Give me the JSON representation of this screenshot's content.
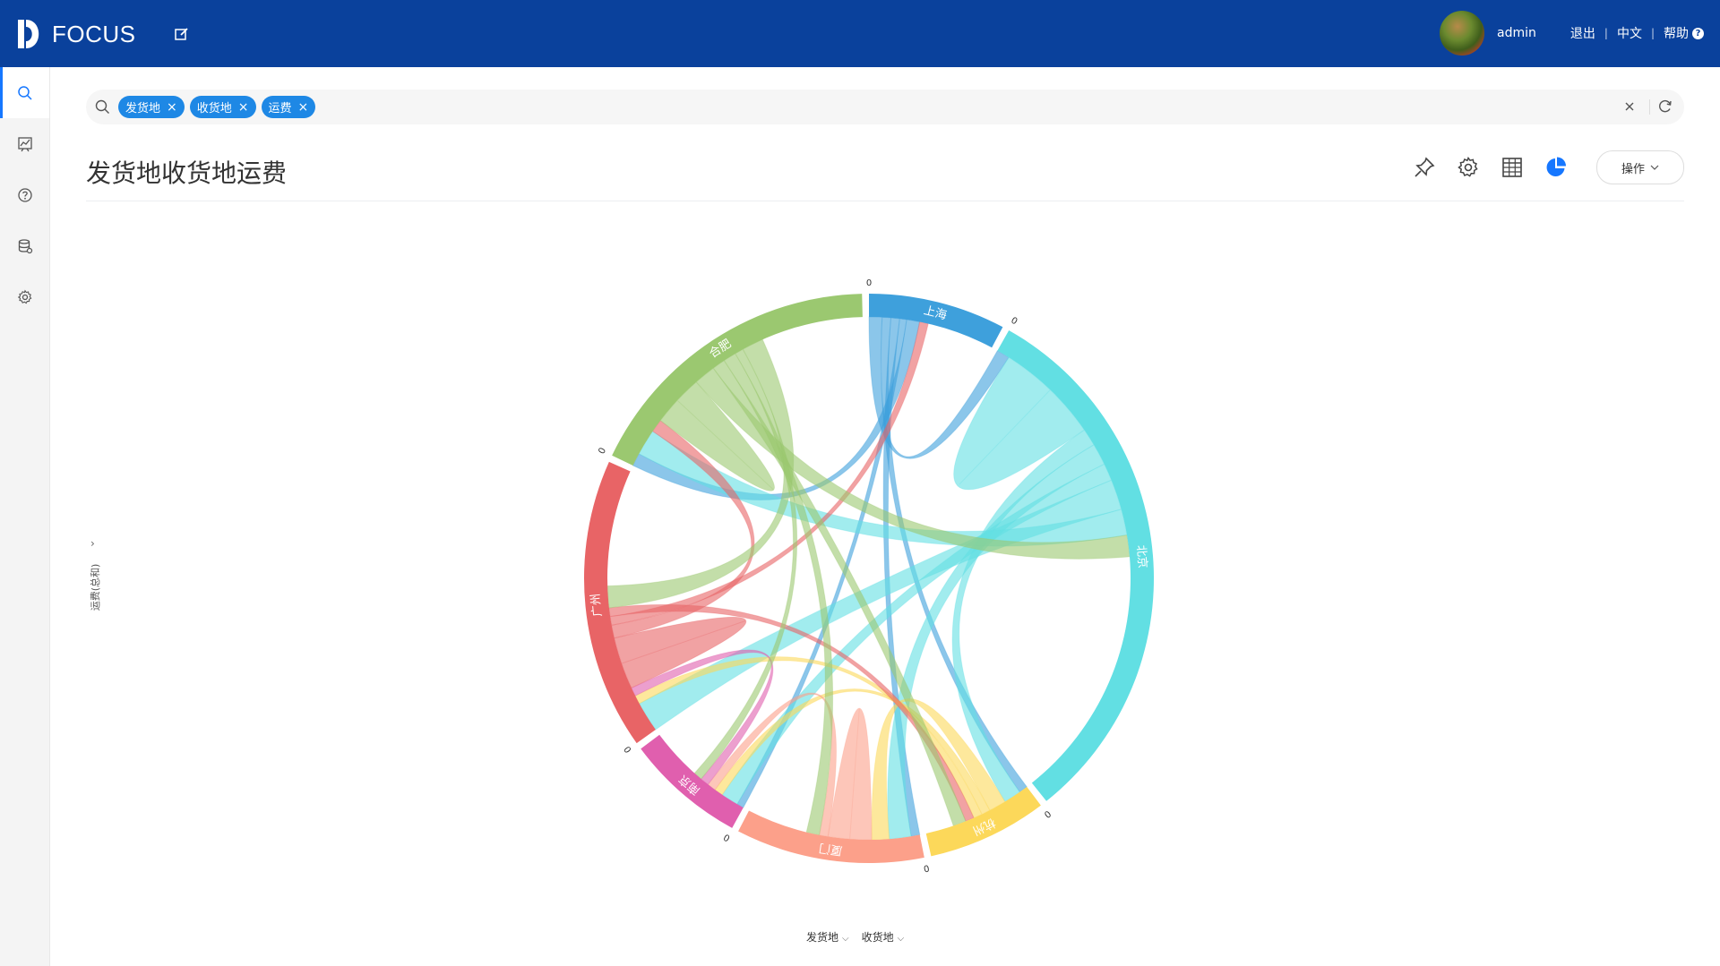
{
  "app": {
    "name": "FOCUS"
  },
  "header": {
    "user": "admin",
    "logout": "退出",
    "language": "中文",
    "help": "帮助",
    "help_icon_glyph": "?"
  },
  "sidebar": {
    "items": [
      {
        "name": "search",
        "icon": "search-icon",
        "active": true
      },
      {
        "name": "dashboard",
        "icon": "chart-board-icon",
        "active": false
      },
      {
        "name": "help",
        "icon": "question-icon",
        "active": false
      },
      {
        "name": "data",
        "icon": "database-icon",
        "active": false
      },
      {
        "name": "settings",
        "icon": "gear-icon",
        "active": false
      }
    ]
  },
  "search": {
    "tags": [
      {
        "label": "发货地"
      },
      {
        "label": "收货地"
      },
      {
        "label": "运费"
      }
    ],
    "tag_remove_glyph": "×",
    "clear_glyph": "×"
  },
  "page": {
    "title": "发货地收货地运费"
  },
  "toolbar": {
    "ops_label": "操作"
  },
  "chart_data": {
    "type": "chord",
    "y_label": "运费(总和)",
    "x_fields": [
      "发货地",
      "收货地"
    ],
    "nodes": [
      {
        "name": "上海",
        "color": "#3ea0dc"
      },
      {
        "name": "北京",
        "color": "#62dfe3"
      },
      {
        "name": "杭州",
        "color": "#fcd85a"
      },
      {
        "name": "厦门",
        "color": "#fca08a"
      },
      {
        "name": "南京",
        "color": "#e05fae"
      },
      {
        "name": "广州",
        "color": "#e86466"
      },
      {
        "name": "合肥",
        "color": "#9bc870"
      }
    ],
    "arc_values": [
      8,
      32,
      7,
      11,
      7,
      17,
      18
    ],
    "start_tick_label": "0",
    "links": [
      {
        "source": "上海",
        "target": "北京",
        "value": 1.5
      },
      {
        "source": "上海",
        "target": "杭州",
        "value": 1
      },
      {
        "source": "上海",
        "target": "厦门",
        "value": 1
      },
      {
        "source": "上海",
        "target": "南京",
        "value": 0.8
      },
      {
        "source": "上海",
        "target": "合肥",
        "value": 1.5
      },
      {
        "source": "北京",
        "target": "北京",
        "value": 6
      },
      {
        "source": "北京",
        "target": "杭州",
        "value": 2
      },
      {
        "source": "北京",
        "target": "厦门",
        "value": 2.5
      },
      {
        "source": "北京",
        "target": "南京",
        "value": 2
      },
      {
        "source": "北京",
        "target": "广州",
        "value": 3.5
      },
      {
        "source": "北京",
        "target": "合肥",
        "value": 3
      },
      {
        "source": "杭州",
        "target": "厦门",
        "value": 2
      },
      {
        "source": "杭州",
        "target": "南京",
        "value": 1
      },
      {
        "source": "杭州",
        "target": "广州",
        "value": 1
      },
      {
        "source": "厦门",
        "target": "厦门",
        "value": 2.5
      },
      {
        "source": "厦门",
        "target": "南京",
        "value": 1
      },
      {
        "source": "南京",
        "target": "广州",
        "value": 1
      },
      {
        "source": "广州",
        "target": "广州",
        "value": 3
      },
      {
        "source": "广州",
        "target": "合肥",
        "value": 1.5
      },
      {
        "source": "广州",
        "target": "上海",
        "value": 1
      },
      {
        "source": "广州",
        "target": "杭州",
        "value": 1
      },
      {
        "source": "合肥",
        "target": "合肥",
        "value": 3
      },
      {
        "source": "合肥",
        "target": "北京",
        "value": 2.5
      },
      {
        "source": "合肥",
        "target": "杭州",
        "value": 1.5
      },
      {
        "source": "合肥",
        "target": "厦门",
        "value": 1.5
      },
      {
        "source": "合肥",
        "target": "南京",
        "value": 1
      },
      {
        "source": "合肥",
        "target": "广州",
        "value": 2.5
      }
    ]
  }
}
